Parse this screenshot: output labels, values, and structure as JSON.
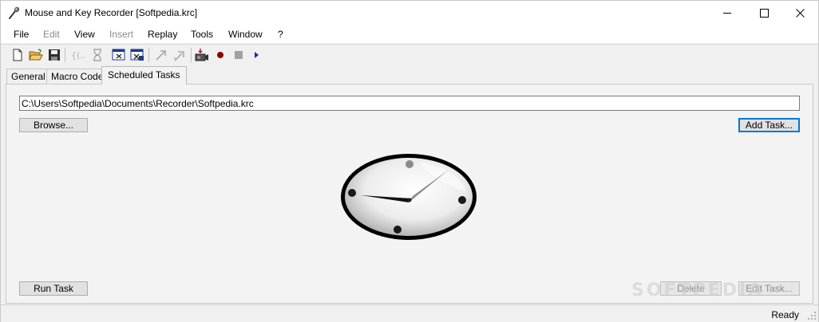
{
  "window": {
    "title": "Mouse and Key Recorder  [Softpedia.krc]"
  },
  "menu": {
    "items": [
      {
        "label": "File",
        "enabled": true
      },
      {
        "label": "Edit",
        "enabled": false
      },
      {
        "label": "View",
        "enabled": true
      },
      {
        "label": "Insert",
        "enabled": false
      },
      {
        "label": "Replay",
        "enabled": true
      },
      {
        "label": "Tools",
        "enabled": true
      },
      {
        "label": "Window",
        "enabled": true
      },
      {
        "label": "?",
        "enabled": true
      }
    ]
  },
  "toolbar": {
    "icons": [
      "new-file-icon",
      "open-folder-icon",
      "save-disk-icon",
      "insert-code-icon",
      "hourglass-icon",
      "window-capture-icon",
      "window-capture-alt-icon",
      "arrow-up-right-icon",
      "arrow-up-right-alt-icon",
      "camera-recorder-icon",
      "record-icon",
      "stop-icon",
      "play-icon"
    ]
  },
  "tabs": [
    {
      "label": "General",
      "active": false
    },
    {
      "label": "Macro Code",
      "active": false
    },
    {
      "label": "Scheduled Tasks",
      "active": true
    }
  ],
  "scheduled": {
    "path_value": "C:\\Users\\Softpedia\\Documents\\Recorder\\Softpedia.krc",
    "browse_label": "Browse...",
    "add_task_label": "Add Task...",
    "run_task_label": "Run Task",
    "delete_label": "Delete",
    "edit_task_label": "Edit Task...",
    "clock_icon": "clock-icon"
  },
  "status": {
    "text": "Ready"
  },
  "watermark": "SOFTPEDIA",
  "colors": {
    "accent": "#0078d7",
    "record": "#8b0000",
    "play": "#1a2ea8"
  }
}
